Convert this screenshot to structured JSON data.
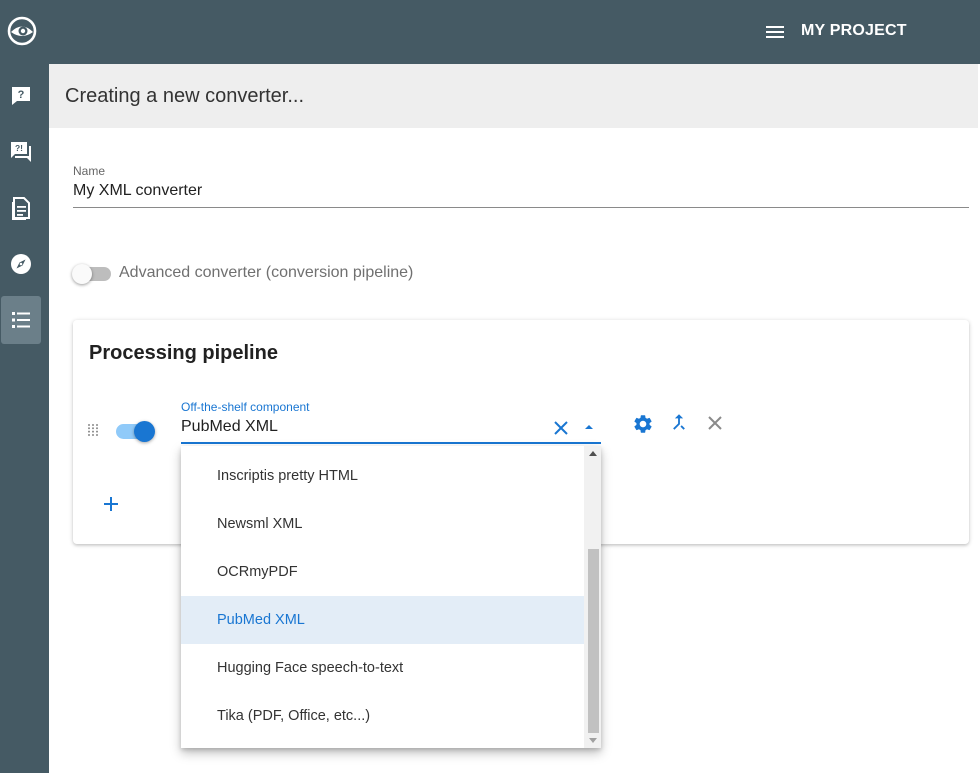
{
  "sidebar": {
    "logo_icon": "eye-logo-icon",
    "items": [
      {
        "icon": "help-message-icon",
        "active": false
      },
      {
        "icon": "comment-alert-icon",
        "active": false
      },
      {
        "icon": "document-icon",
        "active": false
      },
      {
        "icon": "compass-icon",
        "active": false
      },
      {
        "icon": "list-icon",
        "active": true
      }
    ]
  },
  "topbar": {
    "menu_icon": "hamburger-icon",
    "project_title": "MY PROJECT"
  },
  "page": {
    "title": "Creating a new converter..."
  },
  "form": {
    "name_label": "Name",
    "name_value": "My XML converter",
    "advanced_label": "Advanced converter (conversion pipeline)",
    "advanced_enabled": false
  },
  "pipeline": {
    "title": "Processing pipeline",
    "step": {
      "enabled": true,
      "component_label": "Off-the-shelf component",
      "component_value": "PubMed XML"
    }
  },
  "dropdown": {
    "options": [
      "Inscriptis pretty HTML",
      "Newsml XML",
      "OCRmyPDF",
      "PubMed XML",
      "Hugging Face speech-to-text",
      "Tika (PDF, Office, etc...)"
    ],
    "selected": "PubMed XML"
  },
  "colors": {
    "sidebar_bg": "#455a64",
    "accent": "#1976d2",
    "selected_bg": "#e3edf7"
  }
}
